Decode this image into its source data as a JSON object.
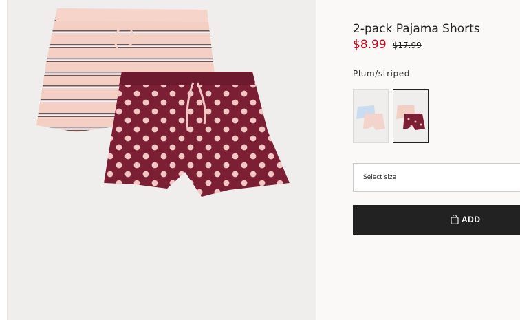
{
  "product": {
    "title": "2-pack Pajama Shorts",
    "sale_price": "$8.99",
    "original_price": "$17.99",
    "color_name": "Plum/striped"
  },
  "swatches": [
    {
      "name": "light blue/pink",
      "selected": false
    },
    {
      "name": "Plum/striped",
      "selected": true
    }
  ],
  "size_select": {
    "placeholder": "Select size"
  },
  "add_button": {
    "label": "ADD",
    "icon": "shopping-bag-icon"
  },
  "colors": {
    "sale_price": "#d6001c",
    "button_bg": "#222222",
    "plum": "#7a1f33",
    "pink": "#f2c4b6",
    "light_blue": "#c9dcf0"
  }
}
